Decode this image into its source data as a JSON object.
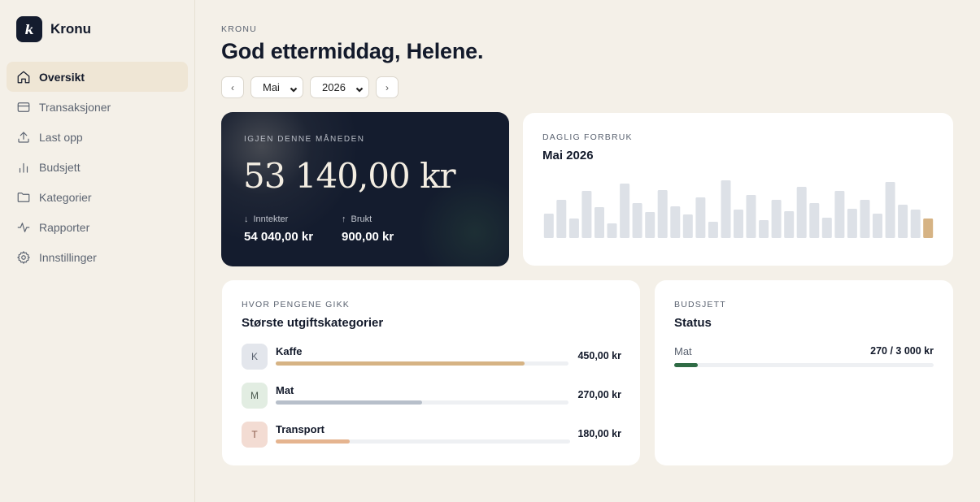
{
  "app": {
    "logo_letter": "k",
    "name": "Kronu"
  },
  "sidebar": {
    "items": [
      {
        "label": "Oversikt",
        "icon": "home-icon",
        "active": true
      },
      {
        "label": "Transaksjoner",
        "icon": "card-icon",
        "active": false
      },
      {
        "label": "Last opp",
        "icon": "upload-icon",
        "active": false
      },
      {
        "label": "Budsjett",
        "icon": "bar-chart-icon",
        "active": false
      },
      {
        "label": "Kategorier",
        "icon": "folder-icon",
        "active": false
      },
      {
        "label": "Rapporter",
        "icon": "pulse-icon",
        "active": false
      },
      {
        "label": "Innstillinger",
        "icon": "gear-icon",
        "active": false
      }
    ]
  },
  "header": {
    "eyebrow": "KRONU",
    "title": "God ettermiddag, Helene.",
    "prev": "‹",
    "next": "›",
    "month": "Mai",
    "year": "2026"
  },
  "balance": {
    "eyebrow": "IGJEN DENNE MÅNEDEN",
    "amount": "53 140,00 kr",
    "income_label": "Inntekter",
    "income_value": "54 040,00 kr",
    "spent_label": "Brukt",
    "spent_value": "900,00 kr"
  },
  "daily": {
    "eyebrow": "DAGLIG FORBRUK",
    "title": "Mai 2026",
    "bar_color": "#dde1e7",
    "highlight_color": "#d6b384",
    "chart_data": {
      "type": "bar",
      "values": [
        30,
        47,
        24,
        58,
        38,
        18,
        67,
        43,
        32,
        59,
        39,
        29,
        50,
        20,
        71,
        35,
        53,
        22,
        47,
        33,
        63,
        43,
        25,
        58,
        36,
        47,
        30,
        69,
        41,
        35,
        24
      ],
      "highlight_index": 30
    }
  },
  "categories": {
    "eyebrow": "HVOR PENGENE GIKK",
    "title": "Største utgiftskategorier",
    "items": [
      {
        "letter": "K",
        "name": "Kaffe",
        "amount": "450,00 kr",
        "share": 0.85,
        "badge_bg": "#e3e6ec",
        "badge_fg": "#5a6270",
        "bar_color": "#d6b384"
      },
      {
        "letter": "M",
        "name": "Mat",
        "amount": "270,00 kr",
        "share": 0.5,
        "badge_bg": "#e2ede2",
        "badge_fg": "#4b5a4f",
        "bar_color": "#b7bfca"
      },
      {
        "letter": "T",
        "name": "Transport",
        "amount": "180,00 kr",
        "share": 0.25,
        "badge_bg": "#f3dcd3",
        "badge_fg": "#8a5a4a",
        "bar_color": "#e5b48f"
      }
    ]
  },
  "budget": {
    "eyebrow": "BUDSJETT",
    "title": "Status",
    "items": [
      {
        "name": "Mat",
        "value": "270 / 3 000 kr",
        "share": 0.09
      }
    ]
  }
}
